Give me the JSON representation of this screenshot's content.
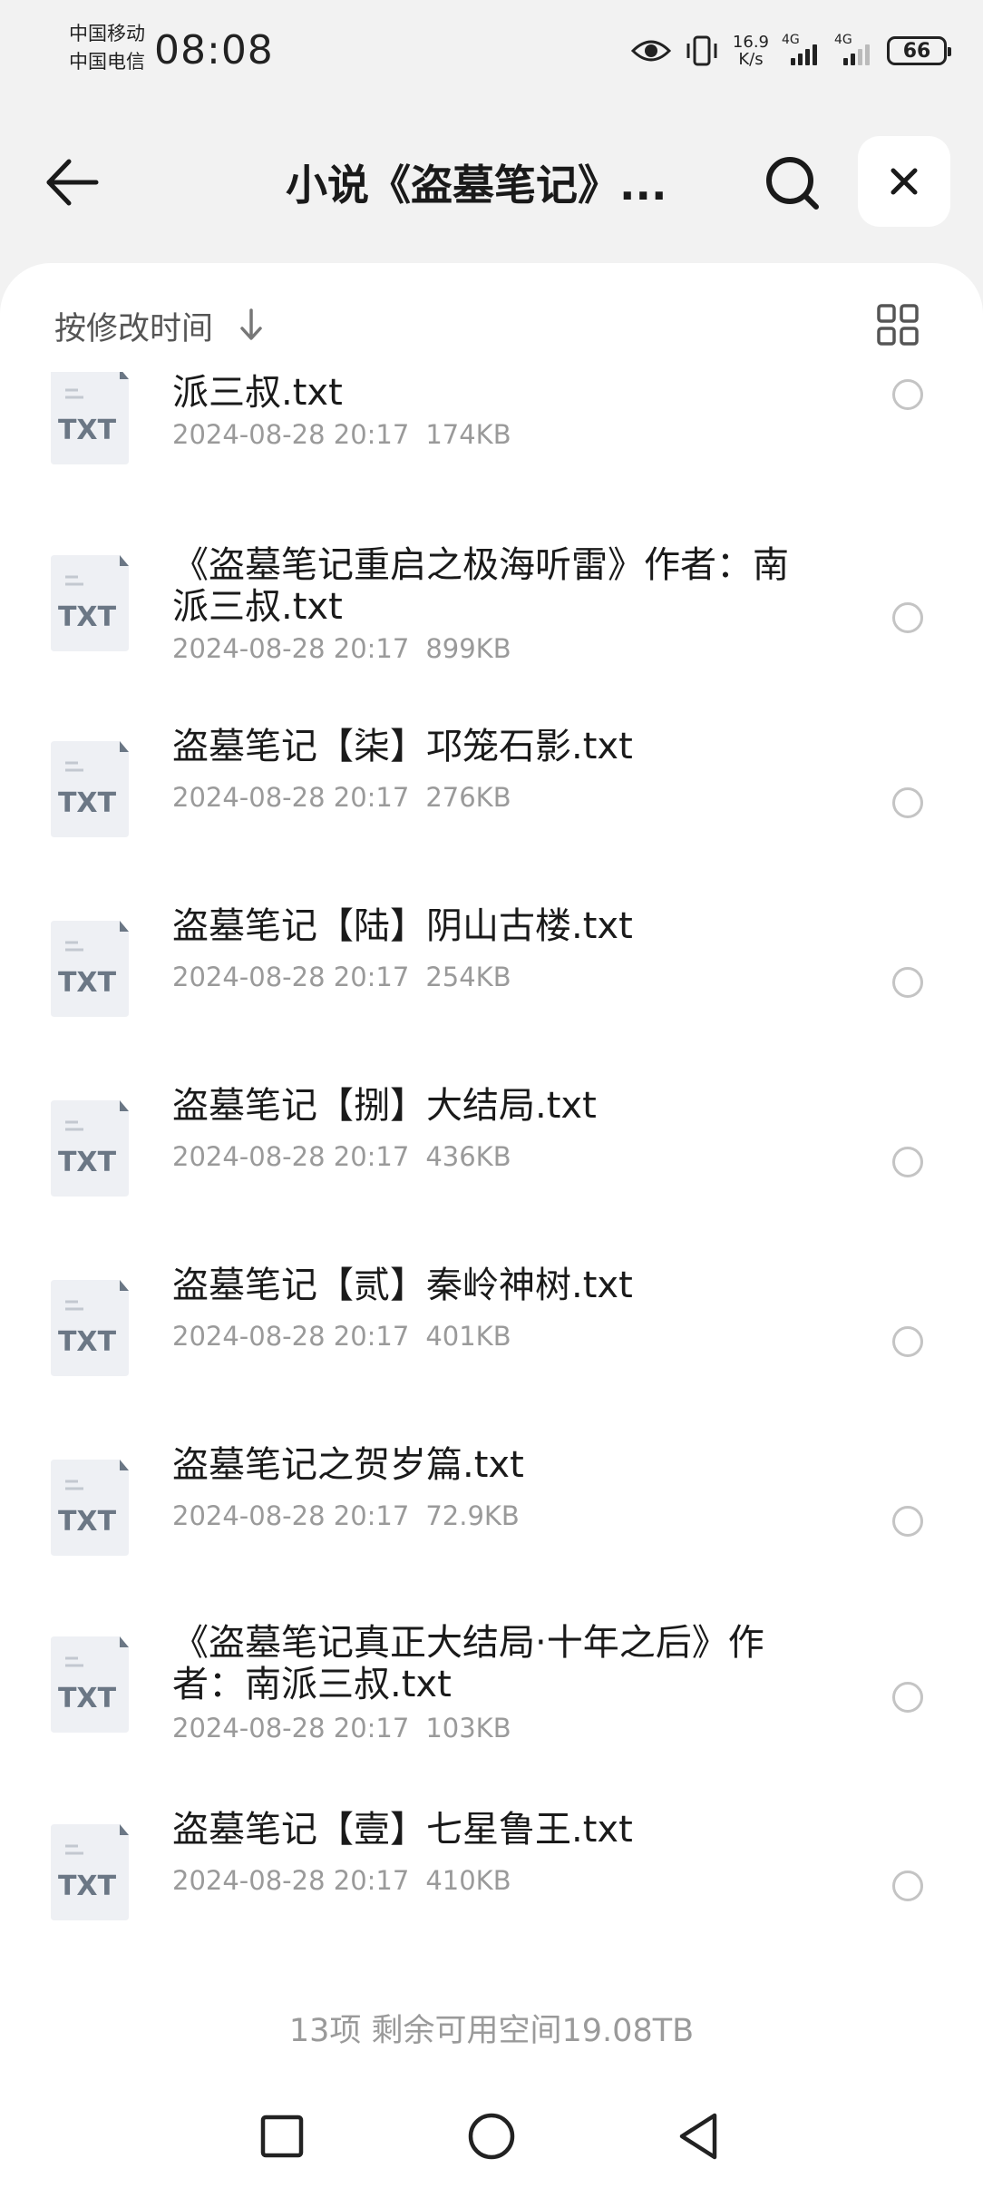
{
  "status_bar": {
    "carrier1": "中国移动",
    "carrier2": "中国电信",
    "time": "08:08",
    "net_speed_value": "16.9",
    "net_speed_unit": "K/s",
    "sim1_type": "4G",
    "sim2_type": "4G",
    "battery": "66"
  },
  "header": {
    "title": "小说《盗墓笔记》..."
  },
  "sort": {
    "label": "按修改时间"
  },
  "files": [
    {
      "name": "派三叔.txt",
      "date": "2024-08-28 20:17",
      "size": "174KB",
      "icon_label": "TXT"
    },
    {
      "name": "《盗墓笔记重启之极海听雷》作者：南派三叔.txt",
      "date": "2024-08-28 20:17",
      "size": "899KB",
      "icon_label": "TXT"
    },
    {
      "name": "盗墓笔记【柒】邛笼石影.txt",
      "date": "2024-08-28 20:17",
      "size": "276KB",
      "icon_label": "TXT"
    },
    {
      "name": "盗墓笔记【陆】阴山古楼.txt",
      "date": "2024-08-28 20:17",
      "size": "254KB",
      "icon_label": "TXT"
    },
    {
      "name": "盗墓笔记【捌】大结局.txt",
      "date": "2024-08-28 20:17",
      "size": "436KB",
      "icon_label": "TXT"
    },
    {
      "name": "盗墓笔记【贰】秦岭神树.txt",
      "date": "2024-08-28 20:17",
      "size": "401KB",
      "icon_label": "TXT"
    },
    {
      "name": "盗墓笔记之贺岁篇.txt",
      "date": "2024-08-28 20:17",
      "size": "72.9KB",
      "icon_label": "TXT"
    },
    {
      "name": "《盗墓笔记真正大结局·十年之后》作者：南派三叔.txt",
      "date": "2024-08-28 20:17",
      "size": "103KB",
      "icon_label": "TXT"
    },
    {
      "name": "盗墓笔记【壹】七星鲁王.txt",
      "date": "2024-08-28 20:17",
      "size": "410KB",
      "icon_label": "TXT"
    }
  ],
  "footer": {
    "summary": "13项 剩余可用空间19.08TB"
  }
}
